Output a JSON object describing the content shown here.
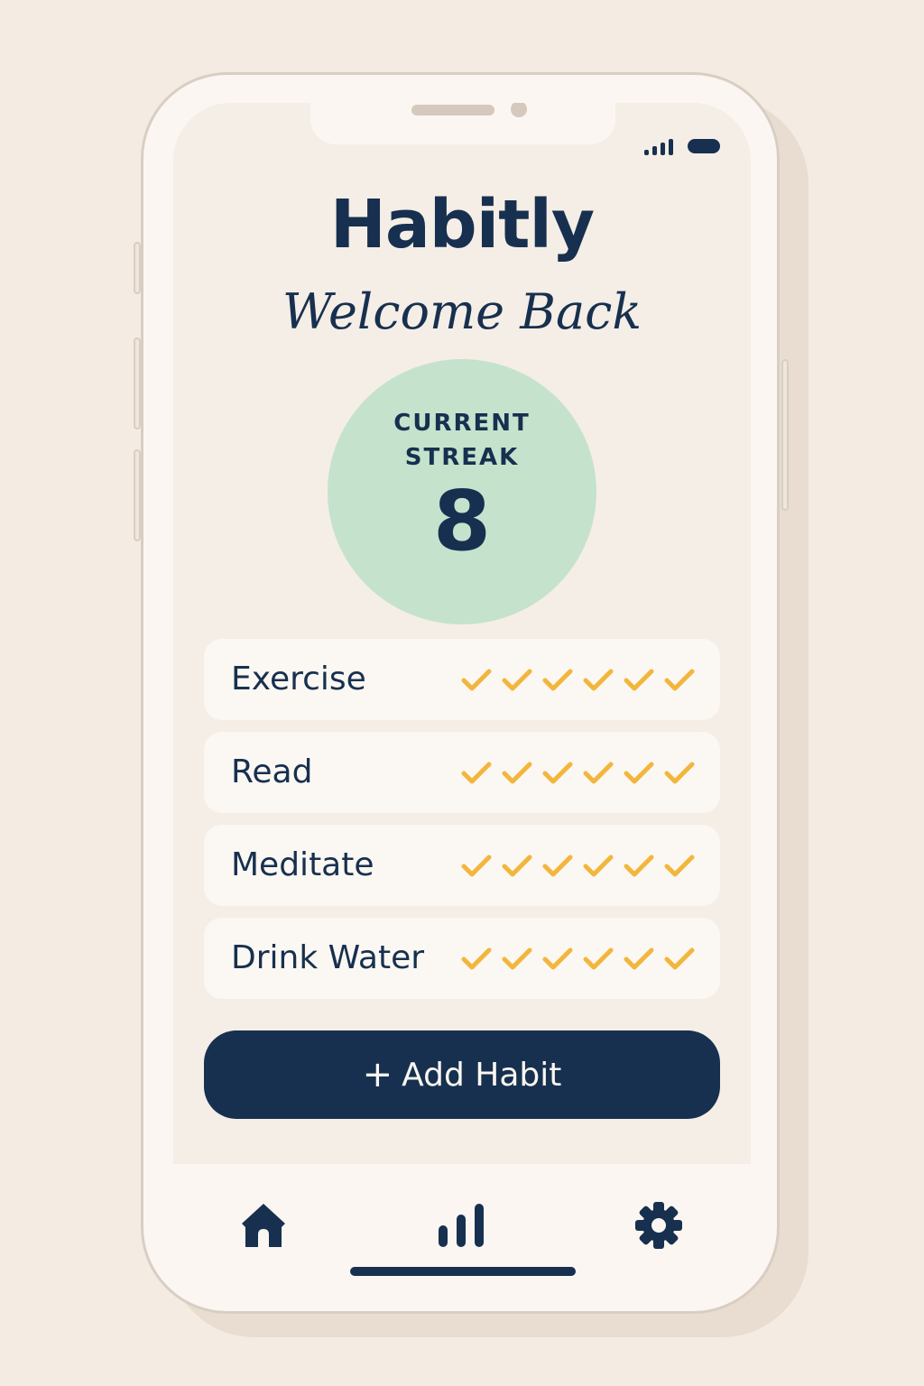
{
  "app": {
    "title": "Habitly",
    "greeting": "Welcome Back"
  },
  "streak": {
    "label": "CURRENT\nSTREAK",
    "value": "8"
  },
  "habits": [
    {
      "name": "Exercise",
      "completed_days": 6
    },
    {
      "name": "Read",
      "completed_days": 6
    },
    {
      "name": "Meditate",
      "completed_days": 6
    },
    {
      "name": "Drink Water",
      "completed_days": 6
    }
  ],
  "actions": {
    "add_habit_icon": "+",
    "add_habit_label": "Add Habit"
  },
  "tab_bar": {
    "items": [
      {
        "icon": "home-icon"
      },
      {
        "icon": "stats-icon"
      },
      {
        "icon": "settings-icon"
      }
    ]
  },
  "colors": {
    "primary": "#17304f",
    "streak_bg": "#c5e2cd",
    "check": "#f2b63d",
    "background": "#f5eee6"
  }
}
